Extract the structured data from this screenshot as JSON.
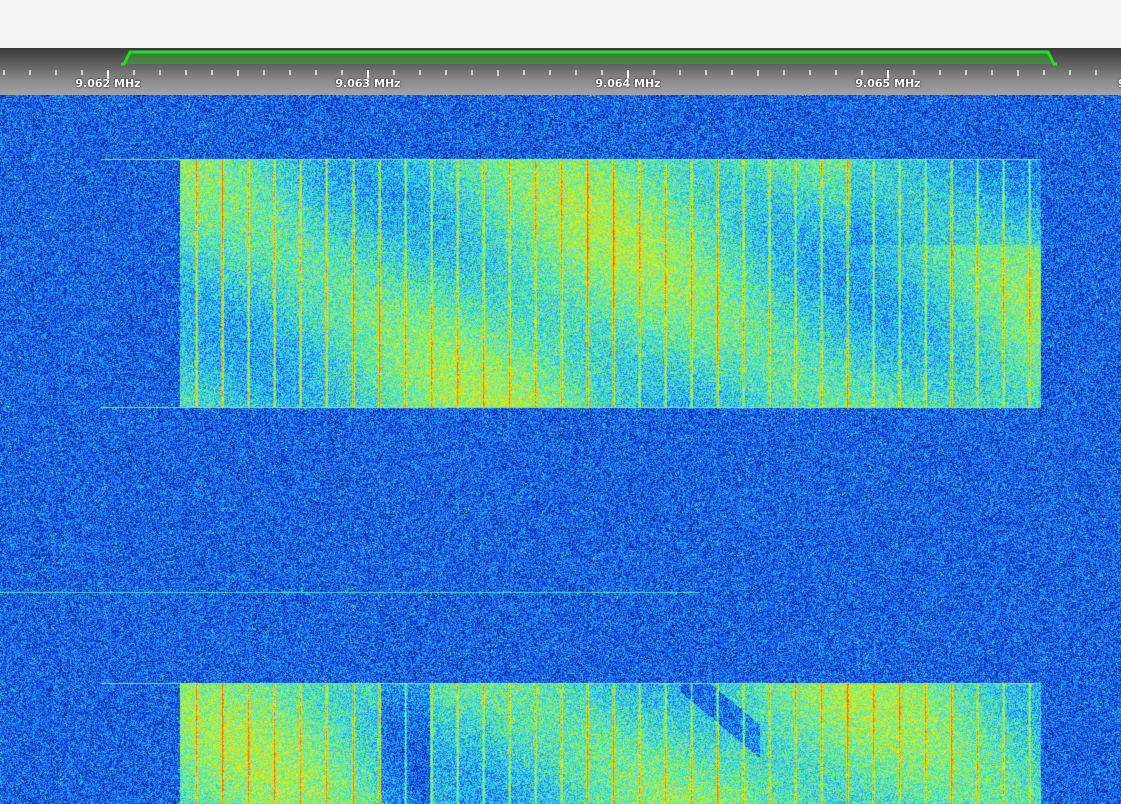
{
  "scale": {
    "labels": [
      {
        "text": "9.062 MHz",
        "mhz": 9.062
      },
      {
        "text": "9.063 MHz",
        "mhz": 9.063
      },
      {
        "text": "9.064 MHz",
        "mhz": 9.064
      },
      {
        "text": "9.065 MHz",
        "mhz": 9.065
      },
      {
        "text": "9",
        "mhz": 9.066
      }
    ],
    "passband_color": "#22dd22"
  },
  "waterfall": {
    "colormap": [
      "#000010",
      "#001a80",
      "#1c5cff",
      "#29d8f0",
      "#8cf070",
      "#f5e800",
      "#ff6a00"
    ]
  }
}
